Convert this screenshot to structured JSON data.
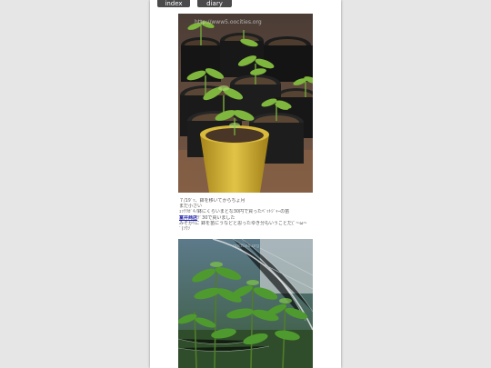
{
  "nav": {
    "index_label": "index",
    "diary_label": "diary index"
  },
  "photos": {
    "top_watermark": "http://www5.oocities.org",
    "bottom_watermark": "oocities.org"
  },
  "caption": {
    "line1": "７/19ﾞｯ、鉢を移いてからちょ月",
    "line2": "まだ小さい",
    "line3": "ｪｯﾃﾘｶﾞｷﾉ鉢にくらいまとな30円で買ったﾍﾟｯﾄｼﾞｬｰの苗",
    "shop_name": "富井商店",
    "line4_rest": "ﾃﾞ30で買いました",
    "line5": "みそかﾘに 鉢を苗にうなどと思ったゆき分もいうことだ(ﾞ~ω~",
    "line6": "ﾞ)ｿｳｿ"
  }
}
